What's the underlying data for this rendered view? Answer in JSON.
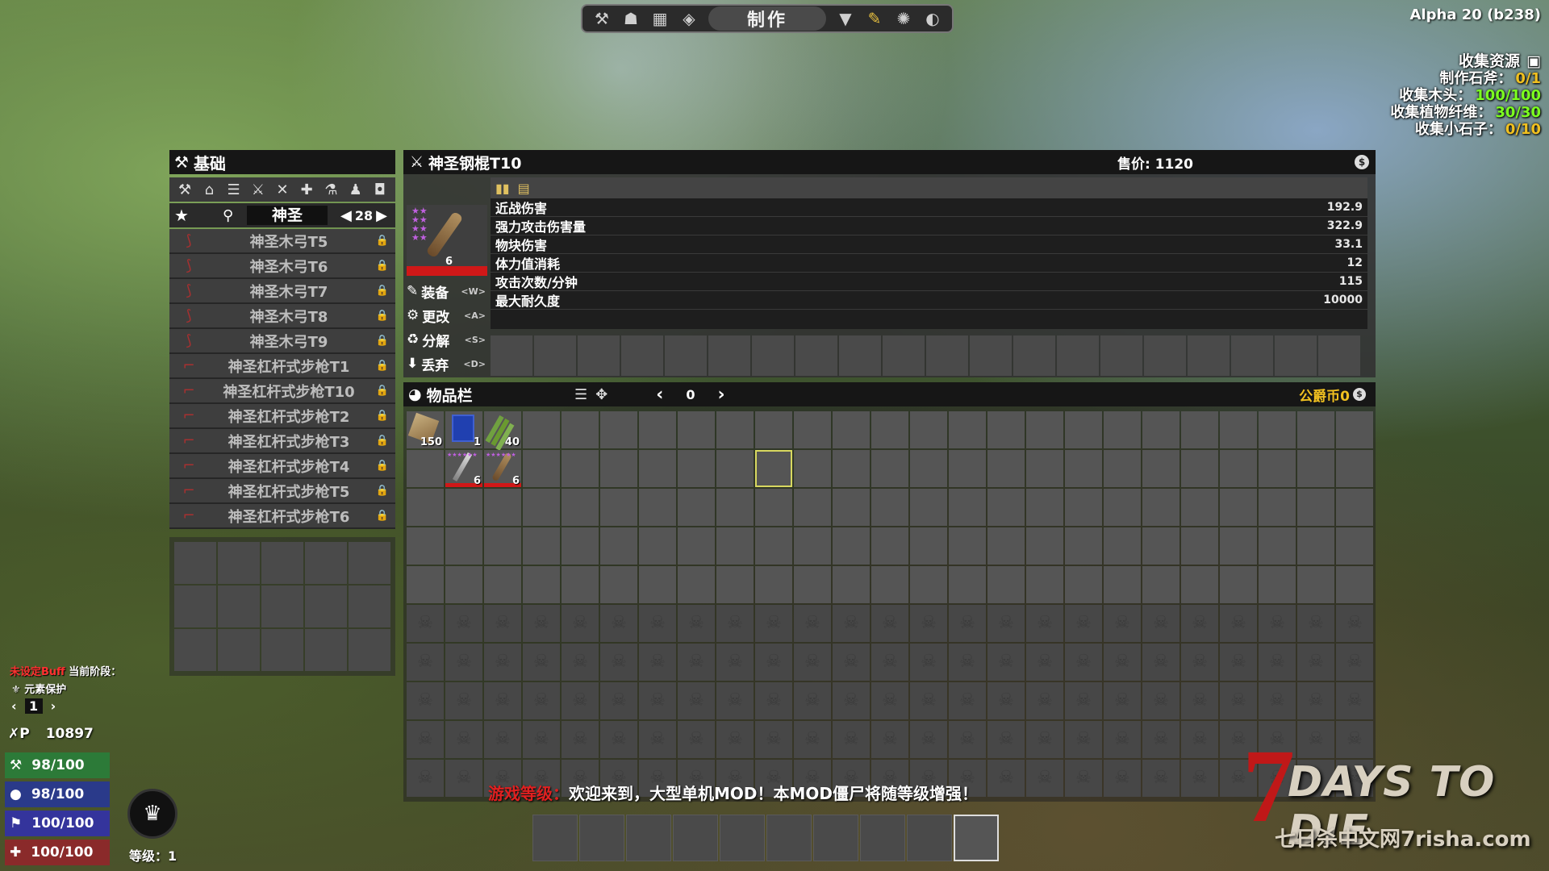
{
  "topbar": {
    "title": "制作",
    "left_icons": [
      "hammer-icon",
      "character-icon",
      "map-icon",
      "skills-icon"
    ],
    "right_icons": [
      "filter-icon",
      "pencil-icon",
      "creative-icon",
      "hint-icon"
    ]
  },
  "version": "Alpha 20 (b238)",
  "quest": {
    "title": "收集资源",
    "rows": [
      {
        "label": "制作石斧：",
        "value": "0/1",
        "color": "#f0c020"
      },
      {
        "label": "收集木头：",
        "value": "100/100",
        "color": "#7cff20"
      },
      {
        "label": "收集植物纤维：",
        "value": "30/30",
        "color": "#7cff20"
      },
      {
        "label": "收集小石子：",
        "value": "0/10",
        "color": "#f0c020"
      }
    ]
  },
  "craft_panel": {
    "title": "基础",
    "category": "神圣",
    "page": "28",
    "recipes": [
      {
        "name": "神圣木弓T5"
      },
      {
        "name": "神圣木弓T6"
      },
      {
        "name": "神圣木弓T7"
      },
      {
        "name": "神圣木弓T8"
      },
      {
        "name": "神圣木弓T9"
      },
      {
        "name": "神圣杠杆式步枪T1"
      },
      {
        "name": "神圣杠杆式步枪T10"
      },
      {
        "name": "神圣杠杆式步枪T2"
      },
      {
        "name": "神圣杠杆式步枪T3"
      },
      {
        "name": "神圣杠杆式步枪T4"
      },
      {
        "name": "神圣杠杆式步枪T5"
      },
      {
        "name": "神圣杠杆式步枪T6"
      }
    ]
  },
  "item_info": {
    "title": "神圣钢棍T10",
    "price": "售价: 1120",
    "quality": "6",
    "actions": [
      {
        "label": "装备",
        "key": "<W>"
      },
      {
        "label": "更改",
        "key": "<A>"
      },
      {
        "label": "分解",
        "key": "<S>"
      },
      {
        "label": "丢弃",
        "key": "<D>"
      }
    ],
    "stats": [
      {
        "label": "近战伤害",
        "value": "192.9"
      },
      {
        "label": "强力攻击伤害量",
        "value": "322.9"
      },
      {
        "label": "物块伤害",
        "value": "33.1"
      },
      {
        "label": "体力值消耗",
        "value": "12"
      },
      {
        "label": "攻击次数/分钟",
        "value": "115"
      },
      {
        "label": "最大耐久度",
        "value": "10000"
      }
    ]
  },
  "backpack": {
    "title": "物品栏",
    "page": "0",
    "currency": "公爵币0",
    "items": [
      {
        "row": 0,
        "col": 0,
        "kind": "wood",
        "qty": "150"
      },
      {
        "row": 0,
        "col": 1,
        "kind": "book",
        "qty": "1"
      },
      {
        "row": 0,
        "col": 2,
        "kind": "fiber",
        "qty": "40"
      },
      {
        "row": 1,
        "col": 1,
        "kind": "blade",
        "qty": "6"
      },
      {
        "row": 1,
        "col": 2,
        "kind": "club",
        "qty": "6"
      }
    ],
    "unlocked_rows": 5,
    "total_rows": 10,
    "cols": 25
  },
  "announcement": {
    "label": "游戏等级：",
    "text": "欢迎来到，大型单机MOD！本MOD僵尸将随等级增强！"
  },
  "hud": {
    "buff_name": "未设定Buff",
    "buff_stage": "当前阶段：",
    "protection": "元素保护",
    "stage_value": "1",
    "xp": "10897",
    "stamina": "98/100",
    "water": "98/100",
    "food": "100/100",
    "health": "100/100",
    "level": "等级：1"
  },
  "logo": {
    "seven": "7",
    "title": "DAYS TO DIE",
    "subtitle": "七日杀中文网7risha.com"
  }
}
